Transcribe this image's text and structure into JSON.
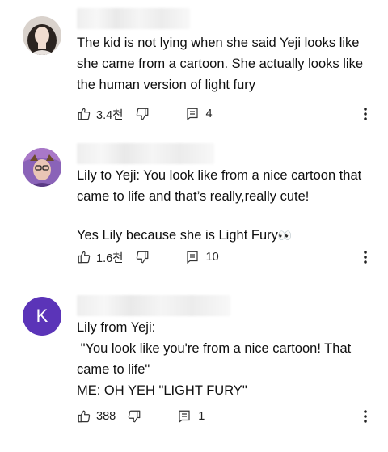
{
  "comments": [
    {
      "avatar_type": "photo",
      "text_lines": [
        "The kid is not lying when she said Yeji looks like she came from a cartoon. She actually looks like the human version of light fury"
      ],
      "likes": "3.4천",
      "replies": "4"
    },
    {
      "avatar_type": "photo-filter",
      "paragraph1": "Lily to Yeji: You look like from a nice cartoon that came to life and that’s really,really cute!",
      "paragraph2": "Yes Lily because she is Light Fury",
      "paragraph2_emoji": "👀",
      "likes": "1.6천",
      "replies": "10"
    },
    {
      "avatar_type": "letter",
      "avatar_letter": "K",
      "avatar_color": "#5b34b8",
      "line1": "Lily from Yeji:",
      "line2": " \"You look like you're from a nice cartoon! That came to life\"",
      "line3": "ME: OH YEH \"LIGHT FURY\"",
      "likes": "388",
      "replies": "1"
    }
  ],
  "icons": {
    "like": "thumbs-up-icon",
    "dislike": "thumbs-down-icon",
    "reply": "reply-icon",
    "more": "more-vert-icon"
  }
}
